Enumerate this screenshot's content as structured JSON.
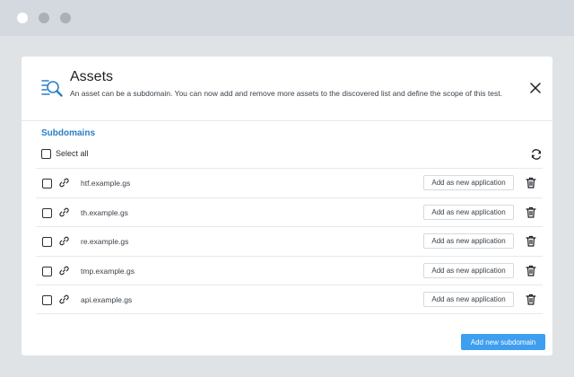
{
  "window": {
    "controls": [
      "close",
      "minimize",
      "maximize"
    ]
  },
  "dialog": {
    "title": "Assets",
    "description": "An asset can be a subdomain. You can now add and remove more assets to the discovered list and define the scope of this test.",
    "icons": {
      "header": "search-document-icon",
      "close": "close-icon",
      "refresh": "refresh-icon",
      "link": "link-icon",
      "delete": "trash-icon"
    }
  },
  "subdomains": {
    "section_title": "Subdomains",
    "select_all_label": "Select all",
    "rows": [
      {
        "domain": "htf.example.gs",
        "action_label": "Add as new application"
      },
      {
        "domain": "th.example.gs",
        "action_label": "Add as new application"
      },
      {
        "domain": "re.example.gs",
        "action_label": "Add as new application"
      },
      {
        "domain": "tmp.example.gs",
        "action_label": "Add as new application"
      },
      {
        "domain": "api.example.gs",
        "action_label": "Add as new application"
      }
    ]
  },
  "footer": {
    "add_subdomain_label": "Add new subdomain"
  },
  "colors": {
    "accent": "#3e9ef0",
    "section_title": "#2a7fc6",
    "icon_blue": "#2a7fc6"
  }
}
